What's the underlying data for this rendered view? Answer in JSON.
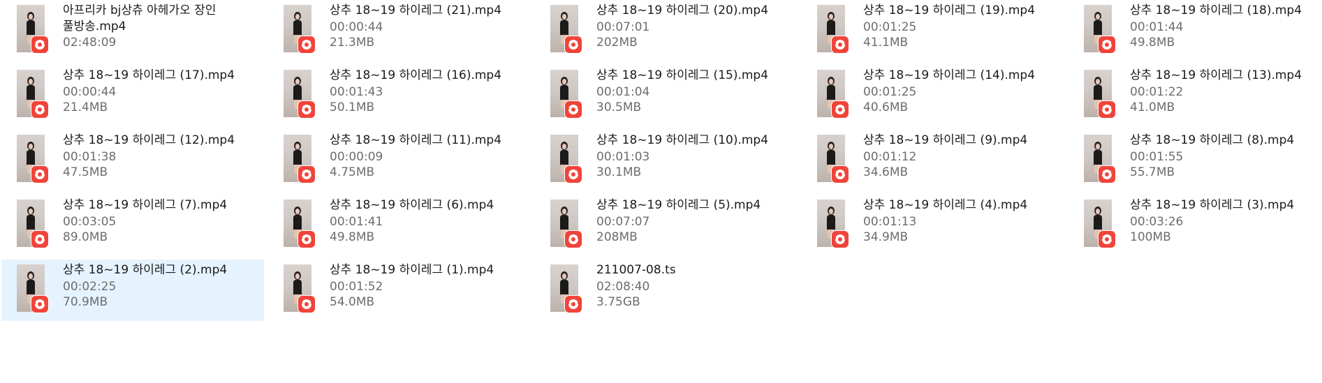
{
  "files": [
    {
      "name": "아프리카 bj상츄 아헤가오 장인 풀방송.mp4",
      "duration": "02:48:09",
      "size": "",
      "selected": false,
      "icon": "video-player-icon"
    },
    {
      "name": "상추 18~19 하이레그 (21).mp4",
      "duration": "00:00:44",
      "size": "21.3MB",
      "selected": false,
      "icon": "video-player-icon"
    },
    {
      "name": "상추 18~19 하이레그 (20).mp4",
      "duration": "00:07:01",
      "size": "202MB",
      "selected": false,
      "icon": "video-player-icon"
    },
    {
      "name": "상추 18~19 하이레그 (19).mp4",
      "duration": "00:01:25",
      "size": "41.1MB",
      "selected": false,
      "icon": "video-player-icon"
    },
    {
      "name": "상추 18~19 하이레그 (18).mp4",
      "duration": "00:01:44",
      "size": "49.8MB",
      "selected": false,
      "icon": "video-player-icon"
    },
    {
      "name": "상추 18~19 하이레그 (17).mp4",
      "duration": "00:00:44",
      "size": "21.4MB",
      "selected": false,
      "icon": "video-player-icon"
    },
    {
      "name": "상추 18~19 하이레그 (16).mp4",
      "duration": "00:01:43",
      "size": "50.1MB",
      "selected": false,
      "icon": "video-player-icon"
    },
    {
      "name": "상추 18~19 하이레그 (15).mp4",
      "duration": "00:01:04",
      "size": "30.5MB",
      "selected": false,
      "icon": "video-player-icon"
    },
    {
      "name": "상추 18~19 하이레그 (14).mp4",
      "duration": "00:01:25",
      "size": "40.6MB",
      "selected": false,
      "icon": "video-player-icon"
    },
    {
      "name": "상추 18~19 하이레그 (13).mp4",
      "duration": "00:01:22",
      "size": "41.0MB",
      "selected": false,
      "icon": "video-player-icon"
    },
    {
      "name": "상추 18~19 하이레그 (12).mp4",
      "duration": "00:01:38",
      "size": "47.5MB",
      "selected": false,
      "icon": "video-player-icon"
    },
    {
      "name": "상추 18~19 하이레그 (11).mp4",
      "duration": "00:00:09",
      "size": "4.75MB",
      "selected": false,
      "icon": "video-player-icon"
    },
    {
      "name": "상추 18~19 하이레그 (10).mp4",
      "duration": "00:01:03",
      "size": "30.1MB",
      "selected": false,
      "icon": "video-player-icon"
    },
    {
      "name": "상추 18~19 하이레그 (9).mp4",
      "duration": "00:01:12",
      "size": "34.6MB",
      "selected": false,
      "icon": "video-player-icon"
    },
    {
      "name": "상추 18~19 하이레그 (8).mp4",
      "duration": "00:01:55",
      "size": "55.7MB",
      "selected": false,
      "icon": "video-player-icon"
    },
    {
      "name": "상추 18~19 하이레그 (7).mp4",
      "duration": "00:03:05",
      "size": "89.0MB",
      "selected": false,
      "icon": "video-player-icon"
    },
    {
      "name": "상추 18~19 하이레그 (6).mp4",
      "duration": "00:01:41",
      "size": "49.8MB",
      "selected": false,
      "icon": "video-player-icon"
    },
    {
      "name": "상추 18~19 하이레그 (5).mp4",
      "duration": "00:07:07",
      "size": "208MB",
      "selected": false,
      "icon": "video-player-icon"
    },
    {
      "name": "상추 18~19 하이레그 (4).mp4",
      "duration": "00:01:13",
      "size": "34.9MB",
      "selected": false,
      "icon": "video-player-icon"
    },
    {
      "name": "상추 18~19 하이레그 (3).mp4",
      "duration": "00:03:26",
      "size": "100MB",
      "selected": false,
      "icon": "video-player-icon"
    },
    {
      "name": "상추 18~19 하이레그 (2).mp4",
      "duration": "00:02:25",
      "size": "70.9MB",
      "selected": true,
      "icon": "video-player-icon"
    },
    {
      "name": "상추 18~19 하이레그 (1).mp4",
      "duration": "00:01:52",
      "size": "54.0MB",
      "selected": false,
      "icon": "video-player-icon"
    },
    {
      "name": "211007-08.ts",
      "duration": "02:08:40",
      "size": "3.75GB",
      "selected": false,
      "icon": "video-player-icon"
    }
  ],
  "colors": {
    "selection": "#e5f3ff",
    "badge": "#f0443a",
    "name_text": "#1a1a1a",
    "meta_text": "#6d6d6d"
  }
}
